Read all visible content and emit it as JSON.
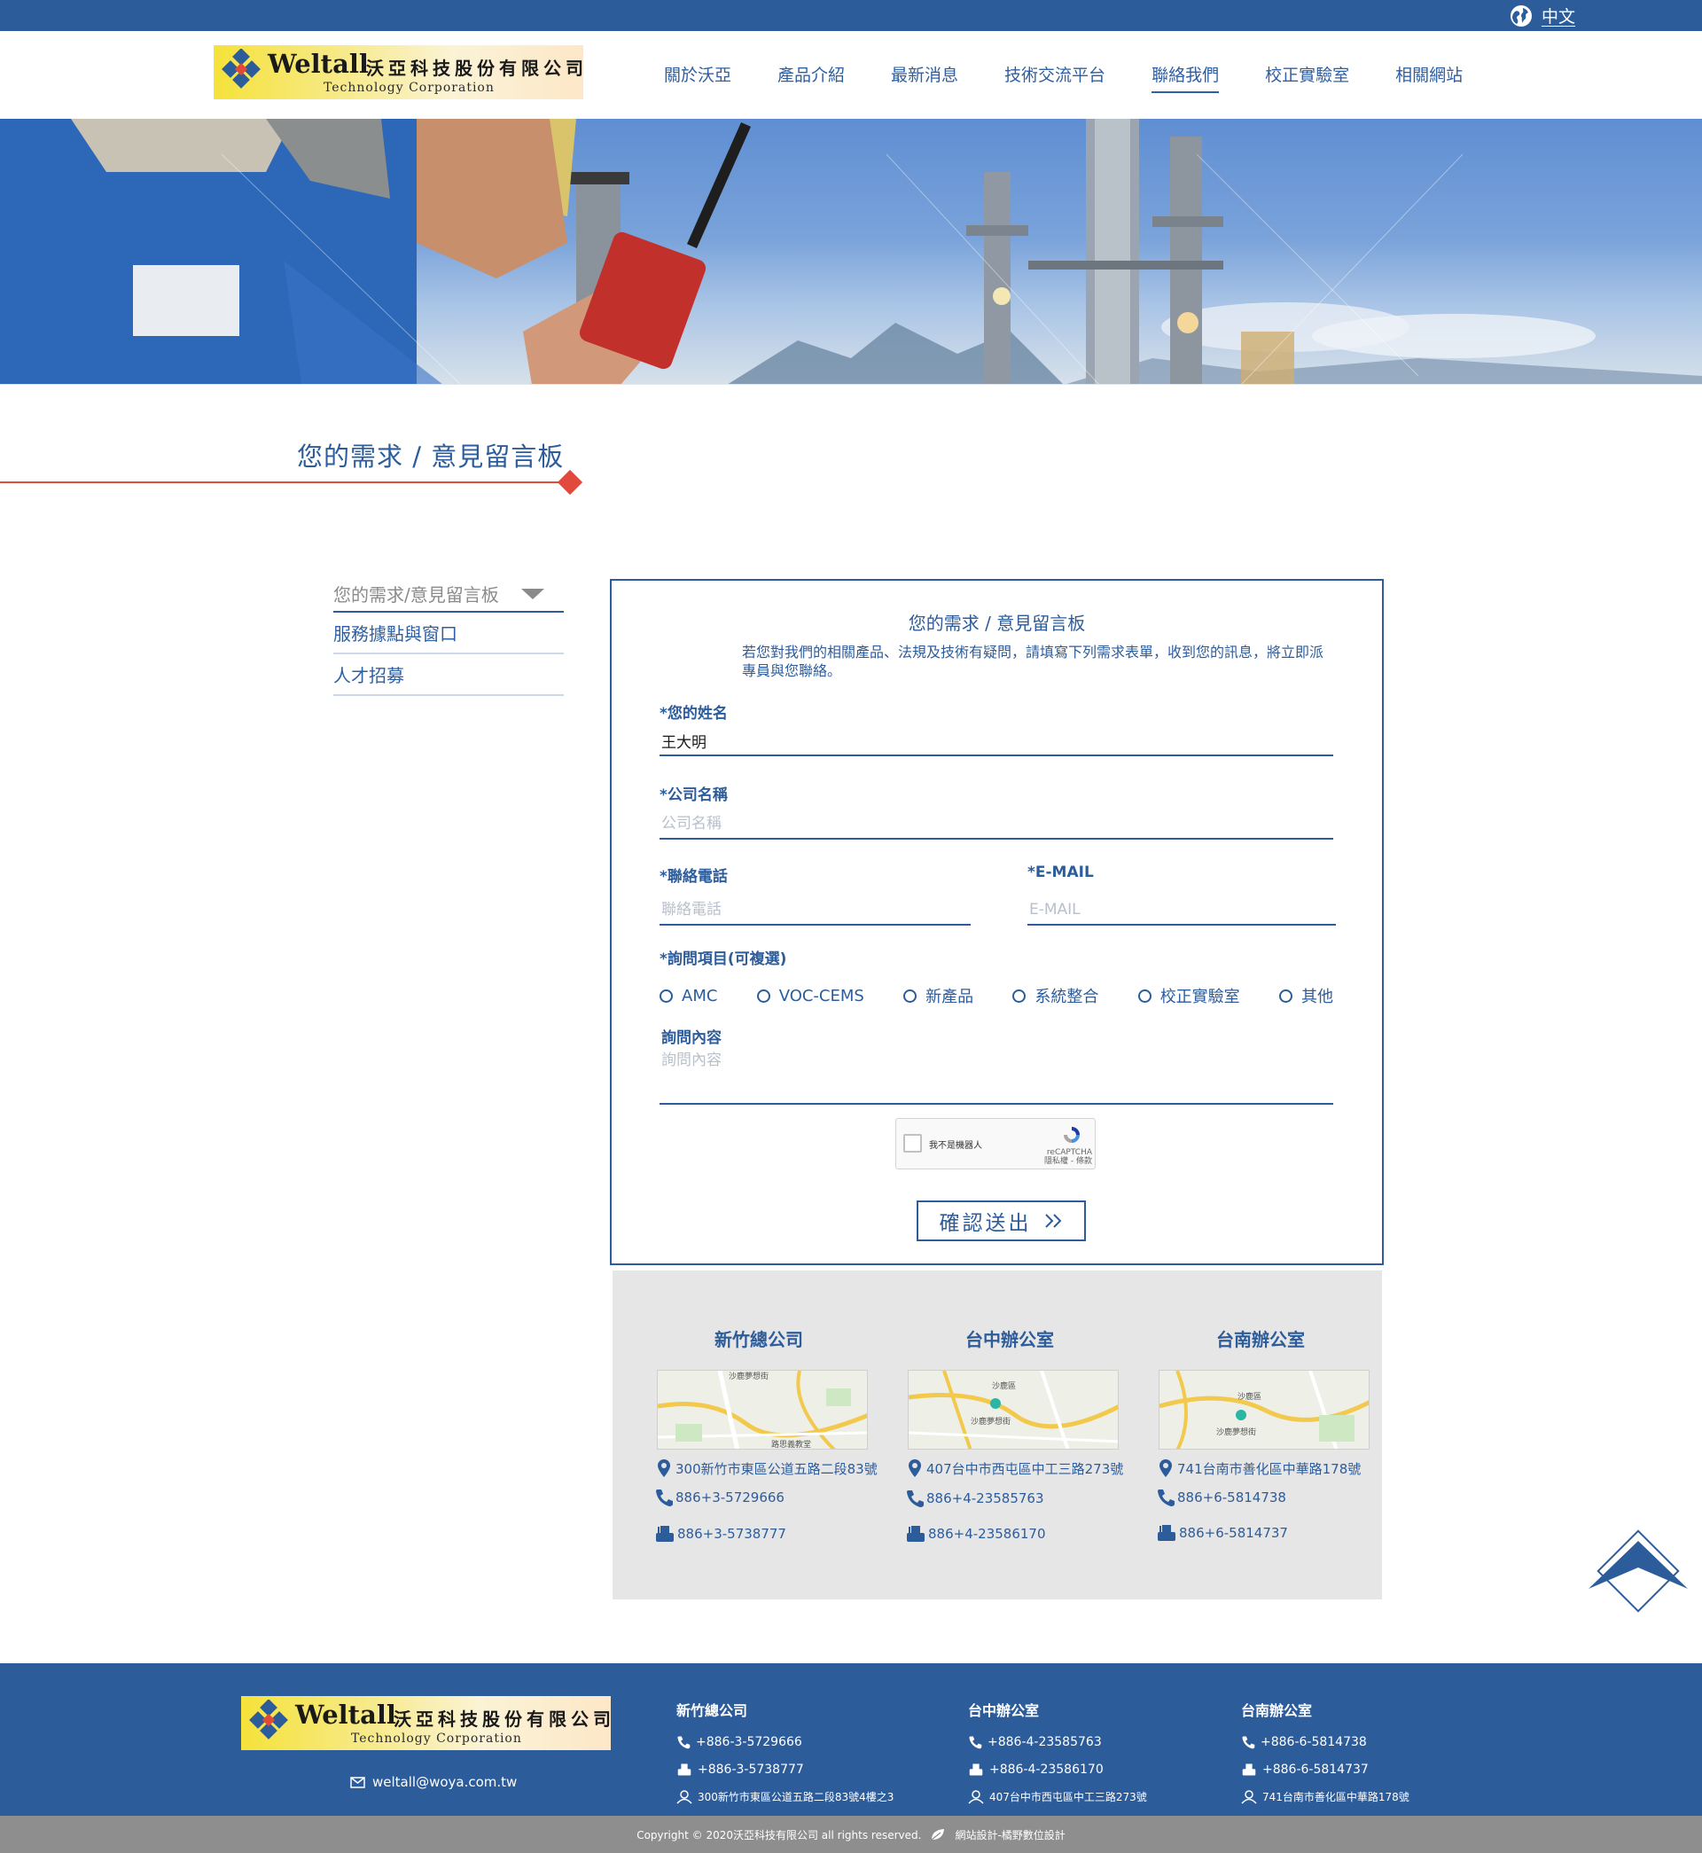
{
  "topbar": {
    "lang_label": "中文",
    "lang_icon": "globe-icon"
  },
  "logo": {
    "brand": "Weltall",
    "brand_cn": "沃亞科技股份有限公司",
    "subtitle": "Technology Corporation"
  },
  "nav": [
    {
      "label": "關於沃亞"
    },
    {
      "label": "產品介紹"
    },
    {
      "label": "最新消息"
    },
    {
      "label": "技術交流平台"
    },
    {
      "label": "聯絡我們",
      "active": true
    },
    {
      "label": "校正實驗室"
    },
    {
      "label": "相關網站"
    }
  ],
  "section": {
    "title": "您的需求 / 意見留言板"
  },
  "side_menu": [
    {
      "label": "您的需求/意見留言板"
    },
    {
      "label": "服務據點與窗口"
    },
    {
      "label": "人才招募"
    }
  ],
  "form": {
    "title": "您的需求 / 意見留言板",
    "intro": "若您對我們的相關產品、法規及技術有疑問，請填寫下列需求表單，收到您的訊息，將立即派專員與您聯絡。",
    "name": {
      "label": "*您的姓名",
      "value": "王大明"
    },
    "company": {
      "label": "*公司名稱",
      "placeholder": "公司名稱"
    },
    "phone": {
      "label": "*聯絡電話",
      "placeholder": "聯絡電話"
    },
    "email": {
      "label": "*E-MAIL",
      "placeholder": "E-MAIL"
    },
    "inquiry": {
      "label": "*詢問項目(可複選)",
      "options": [
        "AMC",
        "VOC-CEMS",
        "新產品",
        "系統整合",
        "校正實驗室",
        "其他"
      ]
    },
    "content": {
      "label": "詢問內容",
      "placeholder": "詢問內容"
    },
    "captcha": {
      "text": "我不是機器人",
      "brand": "reCAPTCHA",
      "links": "隱私權 - 條款"
    },
    "submit_label": "確認送出"
  },
  "offices": [
    {
      "name": "新竹總公司",
      "map_labels": [
        "沙鹿夢想街",
        "路思義教堂"
      ],
      "address": "300新竹市東區公道五路二段83號",
      "phone": "886+3-5729666",
      "fax": "886+3-5738777"
    },
    {
      "name": "台中辦公室",
      "map_labels": [
        "沙鹿區",
        "沙鹿夢想街"
      ],
      "address": "407台中市西屯區中工三路273號",
      "phone": "886+4-23585763",
      "fax": "886+4-23586170"
    },
    {
      "name": "台南辦公室",
      "map_labels": [
        "沙鹿區",
        "沙鹿夢想街"
      ],
      "address": "741台南市善化區中華路178號",
      "phone": "886+6-5814738",
      "fax": "886+6-5814737"
    }
  ],
  "footer": {
    "email": "weltall@woya.com.tw",
    "offices": [
      {
        "name": "新竹總公司",
        "phone": "+886-3-5729666",
        "fax": "+886-3-5738777",
        "address": "300新竹市東區公道五路二段83號4樓之3"
      },
      {
        "name": "台中辦公室",
        "phone": "+886-4-23585763",
        "fax": "+886-4-23586170",
        "address": "407台中市西屯區中工三路273號"
      },
      {
        "name": "台南辦公室",
        "phone": "+886-6-5814738",
        "fax": "+886-6-5814737",
        "address": "741台南市善化區中華路178號"
      }
    ],
    "copyright": "Copyright © 2020沃亞科技有限公司 all rights reserved.",
    "designer": "網站設計-橘野數位設計"
  },
  "colors": {
    "primary": "#2d5c9b",
    "accent": "#e0493c",
    "office_bg": "#e6e6e6",
    "copy_bar": "#8e8e8e"
  }
}
